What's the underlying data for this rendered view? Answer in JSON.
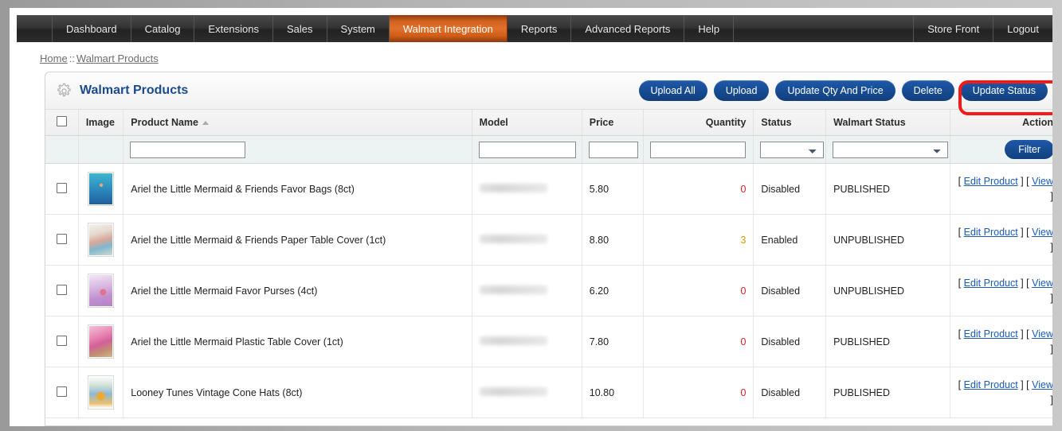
{
  "nav": {
    "items": [
      {
        "label": "Dashboard",
        "active": false
      },
      {
        "label": "Catalog",
        "active": false
      },
      {
        "label": "Extensions",
        "active": false
      },
      {
        "label": "Sales",
        "active": false
      },
      {
        "label": "System",
        "active": false
      },
      {
        "label": "Walmart Integration",
        "active": true
      },
      {
        "label": "Reports",
        "active": false
      },
      {
        "label": "Advanced Reports",
        "active": false
      },
      {
        "label": "Help",
        "active": false
      }
    ],
    "right_items": [
      {
        "label": "Store Front"
      },
      {
        "label": "Logout"
      }
    ]
  },
  "breadcrumb": {
    "home": "Home",
    "separator": "::",
    "current": "Walmart Products"
  },
  "panel": {
    "icon": "gear-icon",
    "title": "Walmart Products",
    "buttons": [
      {
        "label": "Upload All",
        "name": "upload-all-button"
      },
      {
        "label": "Upload",
        "name": "upload-button"
      },
      {
        "label": "Update Qty And Price",
        "name": "update-qty-and-price-button"
      },
      {
        "label": "Delete",
        "name": "delete-button"
      },
      {
        "label": "Update Status",
        "name": "update-status-button",
        "highlighted": true
      }
    ],
    "highlight_color": "#f41a1a"
  },
  "table": {
    "columns": [
      {
        "label": "",
        "name": "select-all-column",
        "align": "center"
      },
      {
        "label": "Image",
        "name": "image-column",
        "align": "left"
      },
      {
        "label": "Product Name",
        "name": "product-name-column",
        "align": "left",
        "sort": "asc"
      },
      {
        "label": "Model",
        "name": "model-column",
        "align": "left"
      },
      {
        "label": "Price",
        "name": "price-column",
        "align": "left"
      },
      {
        "label": "Quantity",
        "name": "quantity-column",
        "align": "right"
      },
      {
        "label": "Status",
        "name": "status-column",
        "align": "left"
      },
      {
        "label": "Walmart Status",
        "name": "walmart-status-column",
        "align": "left"
      },
      {
        "label": "Action",
        "name": "action-column",
        "align": "right"
      }
    ],
    "filter": {
      "product_name_value": "",
      "model_value": "",
      "price_value": "",
      "quantity_value": "",
      "status_value": "",
      "walmart_status_value": "",
      "filter_button_label": "Filter"
    },
    "rows": [
      {
        "checked": false,
        "image": "ariel-mermaid-favor-bags-thumbnail",
        "product_name": "Ariel the Little Mermaid & Friends Favor Bags (8ct)",
        "model": "",
        "model_redacted": true,
        "price": "5.80",
        "quantity": "0",
        "quantity_state": "zero",
        "status": "Disabled",
        "walmart_status": "PUBLISHED",
        "action_edit": "Edit Product",
        "action_view": "View"
      },
      {
        "checked": false,
        "image": "ariel-mermaid-paper-table-cover-thumbnail",
        "product_name": "Ariel the Little Mermaid & Friends Paper Table Cover (1ct)",
        "model": "",
        "model_redacted": true,
        "price": "8.80",
        "quantity": "3",
        "quantity_state": "low",
        "status": "Enabled",
        "walmart_status": "UNPUBLISHED",
        "action_edit": "Edit Product",
        "action_view": "View"
      },
      {
        "checked": false,
        "image": "ariel-mermaid-favor-purses-thumbnail",
        "product_name": "Ariel the Little Mermaid Favor Purses (4ct)",
        "model": "",
        "model_redacted": true,
        "price": "6.20",
        "quantity": "0",
        "quantity_state": "zero",
        "status": "Disabled",
        "walmart_status": "UNPUBLISHED",
        "action_edit": "Edit Product",
        "action_view": "View"
      },
      {
        "checked": false,
        "image": "ariel-mermaid-plastic-table-cover-thumbnail",
        "product_name": "Ariel the Little Mermaid Plastic Table Cover (1ct)",
        "model": "",
        "model_redacted": true,
        "price": "7.80",
        "quantity": "0",
        "quantity_state": "zero",
        "status": "Disabled",
        "walmart_status": "PUBLISHED",
        "action_edit": "Edit Product",
        "action_view": "View"
      },
      {
        "checked": false,
        "image": "looney-tunes-cone-hats-thumbnail",
        "product_name": "Looney Tunes Vintage Cone Hats (8ct)",
        "model": "",
        "model_redacted": true,
        "price": "10.80",
        "quantity": "0",
        "quantity_state": "zero",
        "status": "Disabled",
        "walmart_status": "PUBLISHED",
        "action_edit": "Edit Product",
        "action_view": "View"
      }
    ],
    "action_bracket_open": "[",
    "action_bracket_close": "]"
  }
}
